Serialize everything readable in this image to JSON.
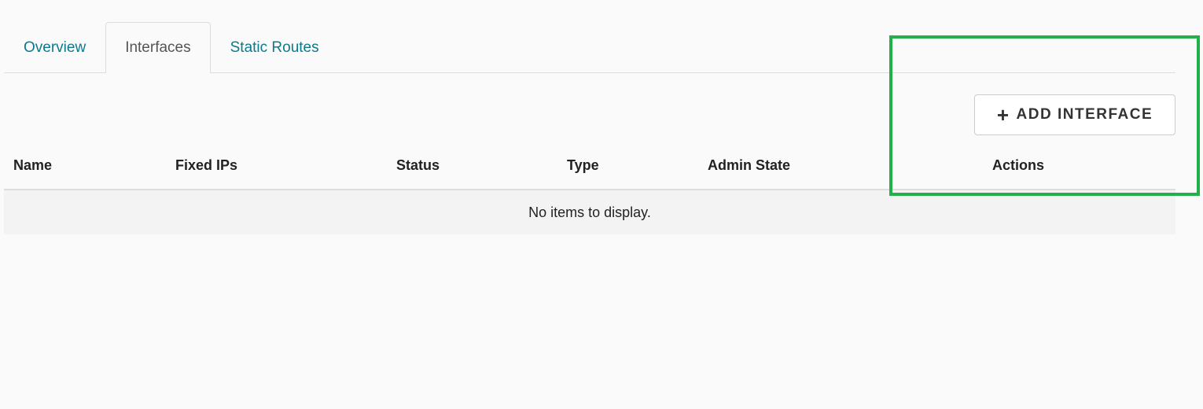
{
  "tabs": [
    {
      "label": "Overview",
      "active": false
    },
    {
      "label": "Interfaces",
      "active": true
    },
    {
      "label": "Static Routes",
      "active": false
    }
  ],
  "actions": {
    "add_interface_icon": "plus-icon",
    "add_interface_label": "ADD INTERFACE"
  },
  "table": {
    "columns": [
      "Name",
      "Fixed IPs",
      "Status",
      "Type",
      "Admin State",
      "Actions"
    ],
    "empty_message": "No items to display."
  },
  "colors": {
    "link": "#0b7a8a",
    "highlight": "#22b04a"
  }
}
